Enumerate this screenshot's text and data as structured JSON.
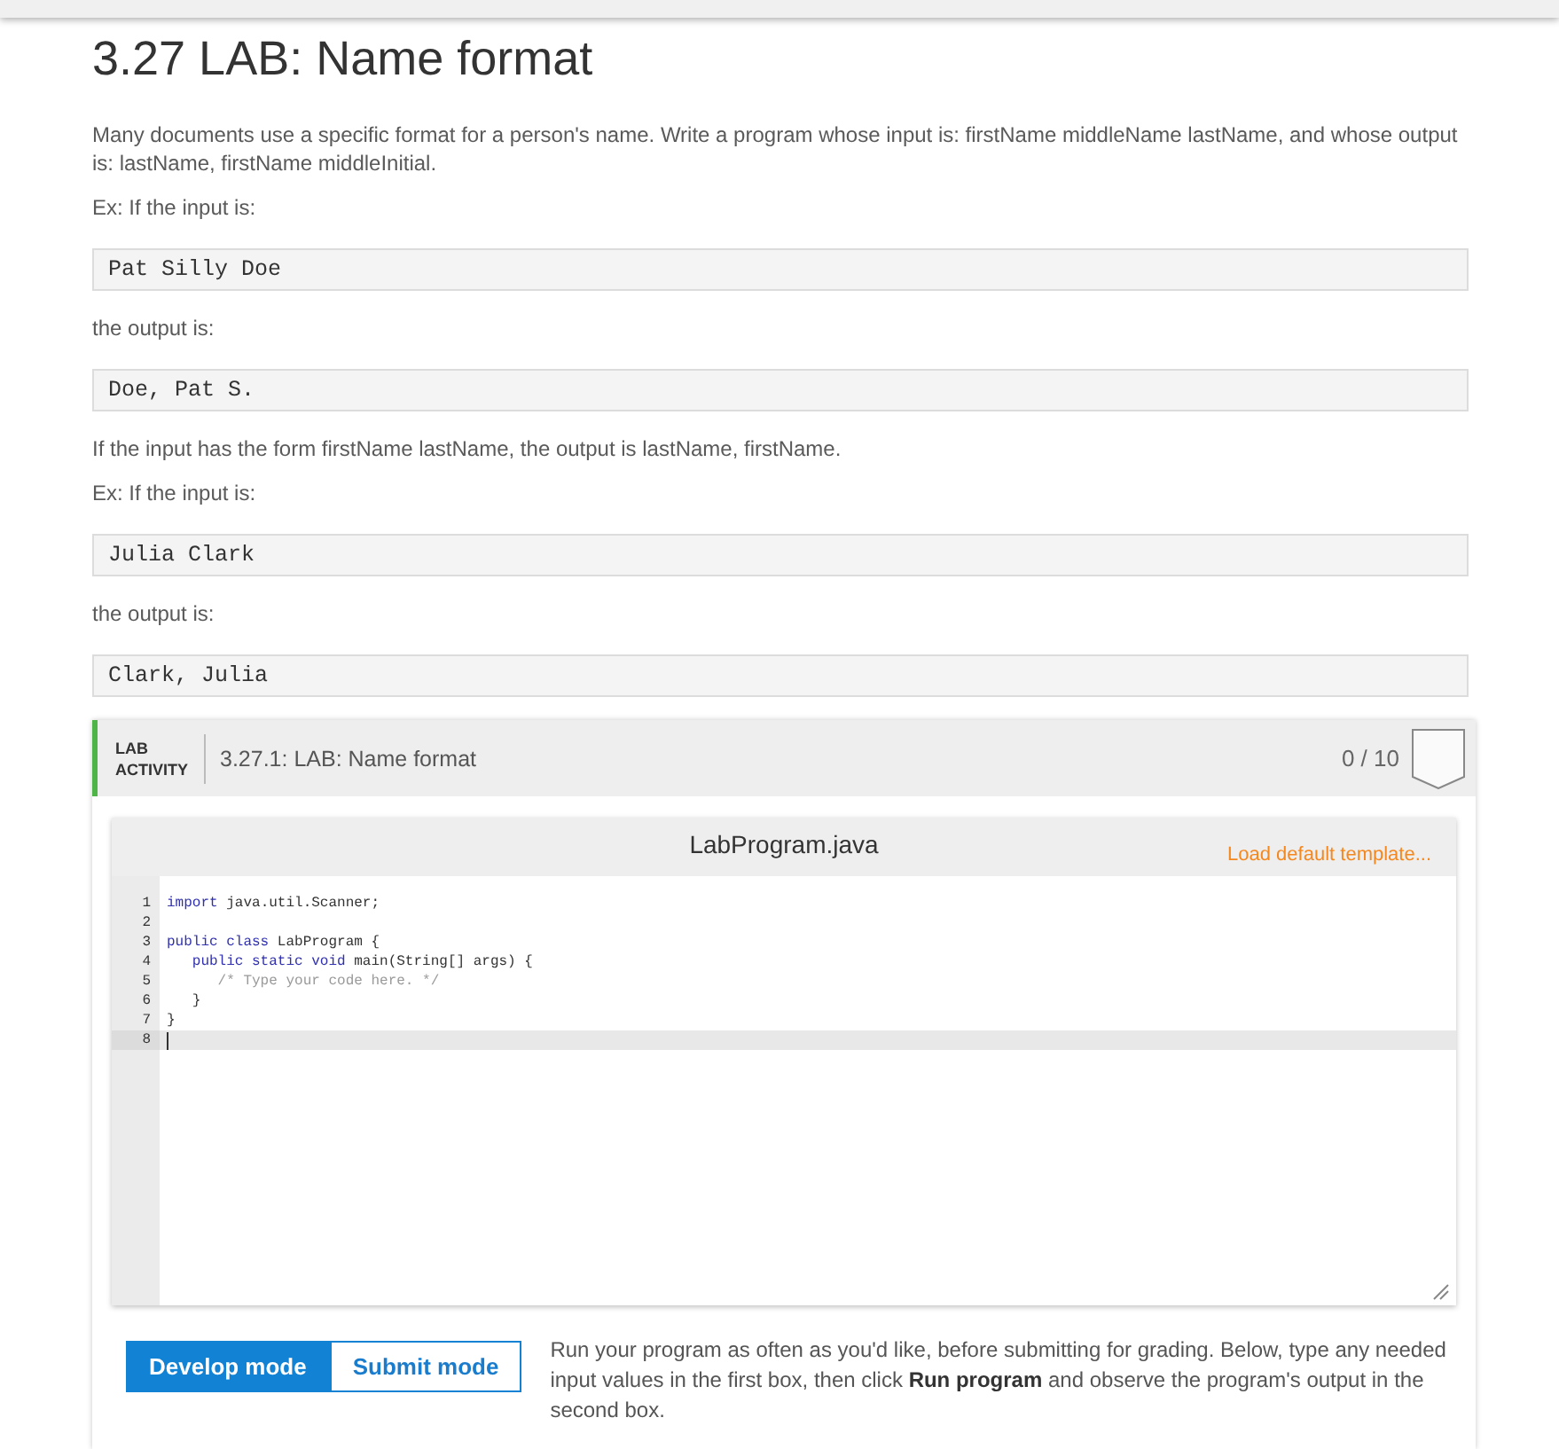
{
  "title": "3.27 LAB: Name format",
  "content": [
    {
      "kind": "text",
      "text": "Many documents use a specific format for a person's name. Write a program whose input is: firstName middleName lastName, and whose output is: lastName, firstName middleInitial."
    },
    {
      "kind": "text",
      "text": "Ex: If the input is:"
    },
    {
      "kind": "code",
      "text": "Pat Silly Doe"
    },
    {
      "kind": "text",
      "text": "the output is:"
    },
    {
      "kind": "code",
      "text": "Doe, Pat S."
    },
    {
      "kind": "text",
      "text": "If the input has the form firstName lastName, the output is lastName, firstName."
    },
    {
      "kind": "text",
      "text": "Ex: If the input is:"
    },
    {
      "kind": "code",
      "text": "Julia Clark"
    },
    {
      "kind": "text",
      "text": "the output is:"
    },
    {
      "kind": "code",
      "text": "Clark, Julia"
    }
  ],
  "lab": {
    "type_label": "LAB ACTIVITY",
    "title": "3.27.1: LAB: Name format",
    "score": "0 / 10"
  },
  "editor": {
    "filename": "LabProgram.java",
    "template_link": "Load default template...",
    "lines": [
      {
        "number": "1",
        "active": false,
        "tokens": [
          {
            "kind": "keyword",
            "text": "import"
          },
          {
            "kind": "plain",
            "text": " java.util.Scanner;"
          }
        ]
      },
      {
        "number": "2",
        "active": false
      },
      {
        "number": "3",
        "active": false,
        "tokens": [
          {
            "kind": "keyword",
            "text": "public class"
          },
          {
            "kind": "plain",
            "text": " LabProgram {"
          }
        ]
      },
      {
        "number": "4",
        "active": false,
        "tokens": [
          {
            "kind": "keyword",
            "text": "   public static void"
          },
          {
            "kind": "plain",
            "text": " main(String[] args) {"
          }
        ]
      },
      {
        "number": "5",
        "active": false,
        "tokens": [
          {
            "kind": "comment",
            "text": "      /* Type your code here. */"
          }
        ]
      },
      {
        "number": "6",
        "active": false,
        "tokens": [
          {
            "kind": "plain",
            "text": "   }"
          }
        ]
      },
      {
        "number": "7",
        "active": false,
        "tokens": [
          {
            "kind": "plain",
            "text": "}"
          }
        ]
      },
      {
        "number": "8",
        "active": true
      }
    ]
  },
  "modes": [
    {
      "label": "Develop mode",
      "selected": true
    },
    {
      "label": "Submit mode",
      "selected": false
    }
  ],
  "instructions": "Run your program as often as you'd like, before submitting for grading. Below, type any needed input values in the first box, then click **Run program** and observe the program's output in the second box."
}
